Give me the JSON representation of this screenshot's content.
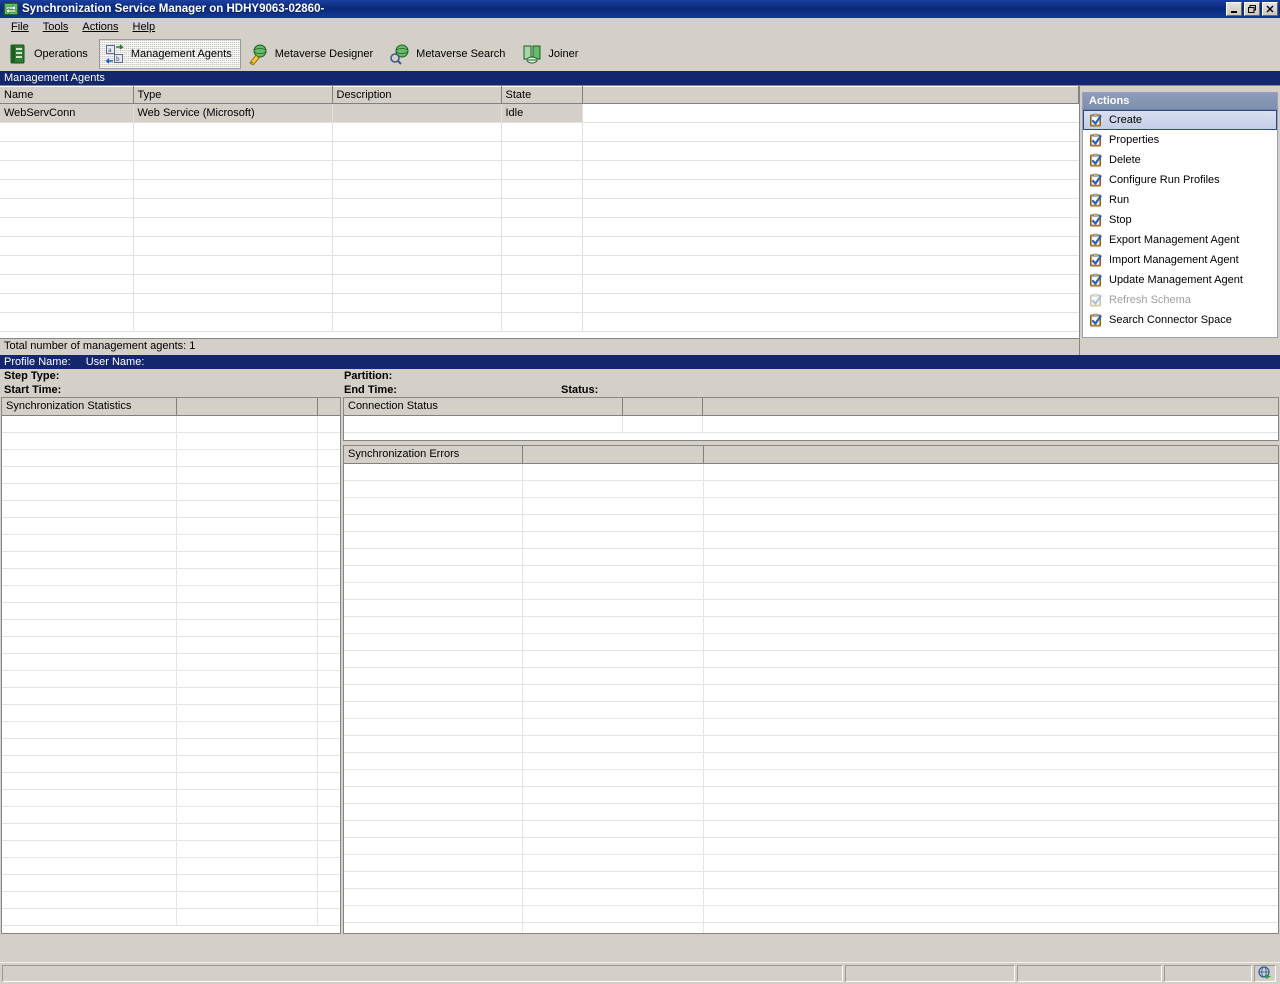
{
  "window": {
    "title": "Synchronization Service Manager on HDHY9063-02860-",
    "app_icon": "sync-app-icon",
    "buttons": {
      "minimize": "_",
      "restore": "❐",
      "close": "✕"
    }
  },
  "menubar": {
    "items": [
      {
        "label": "File",
        "accel": "F"
      },
      {
        "label": "Tools",
        "accel": "T"
      },
      {
        "label": "Actions",
        "accel": "A"
      },
      {
        "label": "Help",
        "accel": "H"
      }
    ]
  },
  "toolbar": {
    "buttons": [
      {
        "label": "Operations",
        "icon": "operations-icon",
        "pressed": false
      },
      {
        "label": "Management Agents",
        "icon": "management-agents-icon",
        "pressed": true
      },
      {
        "label": "Metaverse Designer",
        "icon": "metaverse-designer-icon",
        "pressed": false
      },
      {
        "label": "Metaverse Search",
        "icon": "metaverse-search-icon",
        "pressed": false
      },
      {
        "label": "Joiner",
        "icon": "joiner-icon",
        "pressed": false
      }
    ]
  },
  "agents_section": {
    "header": "Management Agents",
    "columns": [
      "Name",
      "Type",
      "Description",
      "State"
    ],
    "rows": [
      {
        "name": "WebServConn",
        "type": "Web Service (Microsoft)",
        "description": "",
        "state": "Idle",
        "selected": true
      }
    ],
    "empty_row_count": 11,
    "status": "Total number of management agents: 1"
  },
  "actions_pane": {
    "title": "Actions",
    "items": [
      {
        "label": "Create",
        "icon": "action-create-icon",
        "selected": true,
        "disabled": false
      },
      {
        "label": "Properties",
        "icon": "action-properties-icon",
        "selected": false,
        "disabled": false
      },
      {
        "label": "Delete",
        "icon": "action-delete-icon",
        "selected": false,
        "disabled": false
      },
      {
        "label": "Configure Run Profiles",
        "icon": "action-configure-icon",
        "selected": false,
        "disabled": false
      },
      {
        "label": "Run",
        "icon": "action-run-icon",
        "selected": false,
        "disabled": false
      },
      {
        "label": "Stop",
        "icon": "action-stop-icon",
        "selected": false,
        "disabled": false
      },
      {
        "label": "Export Management Agent",
        "icon": "action-export-icon",
        "selected": false,
        "disabled": false
      },
      {
        "label": "Import Management Agent",
        "icon": "action-import-icon",
        "selected": false,
        "disabled": false
      },
      {
        "label": "Update Management Agent",
        "icon": "action-update-icon",
        "selected": false,
        "disabled": false
      },
      {
        "label": "Refresh Schema",
        "icon": "action-refresh-icon",
        "selected": false,
        "disabled": true
      },
      {
        "label": "Search Connector Space",
        "icon": "action-search-icon",
        "selected": false,
        "disabled": false
      }
    ]
  },
  "run_detail": {
    "profile_name_label": "Profile Name:",
    "profile_name_value": "",
    "user_name_label": "User Name:",
    "user_name_value": "",
    "step_type_label": "Step Type:",
    "step_type_value": "",
    "partition_label": "Partition:",
    "partition_value": "",
    "start_time_label": "Start Time:",
    "start_time_value": "",
    "end_time_label": "End Time:",
    "end_time_value": "",
    "status_label": "Status:",
    "status_value": ""
  },
  "sync_statistics": {
    "header": "Synchronization Statistics",
    "columns": [
      "Synchronization Statistics",
      "",
      ""
    ],
    "rows": [],
    "empty_row_count": 30
  },
  "connection_status": {
    "header": "Connection Status",
    "columns": [
      "Connection Status",
      "",
      ""
    ],
    "rows": [],
    "empty_row_count": 1
  },
  "sync_errors": {
    "header": "Synchronization Errors",
    "columns": [
      "Synchronization Errors",
      "",
      ""
    ],
    "rows": [],
    "empty_row_count": 28
  },
  "statusbar": {
    "panels": [
      "",
      "",
      "",
      ""
    ],
    "icon": "network-run-icon"
  },
  "colors": {
    "window_face": "#d4d0c8",
    "title_bar": "#0a2a7a",
    "section_header": "#13266e",
    "actions_header": "#7f8fb0",
    "selection": "#d4d0c8",
    "accent": "#2a4a8a"
  }
}
